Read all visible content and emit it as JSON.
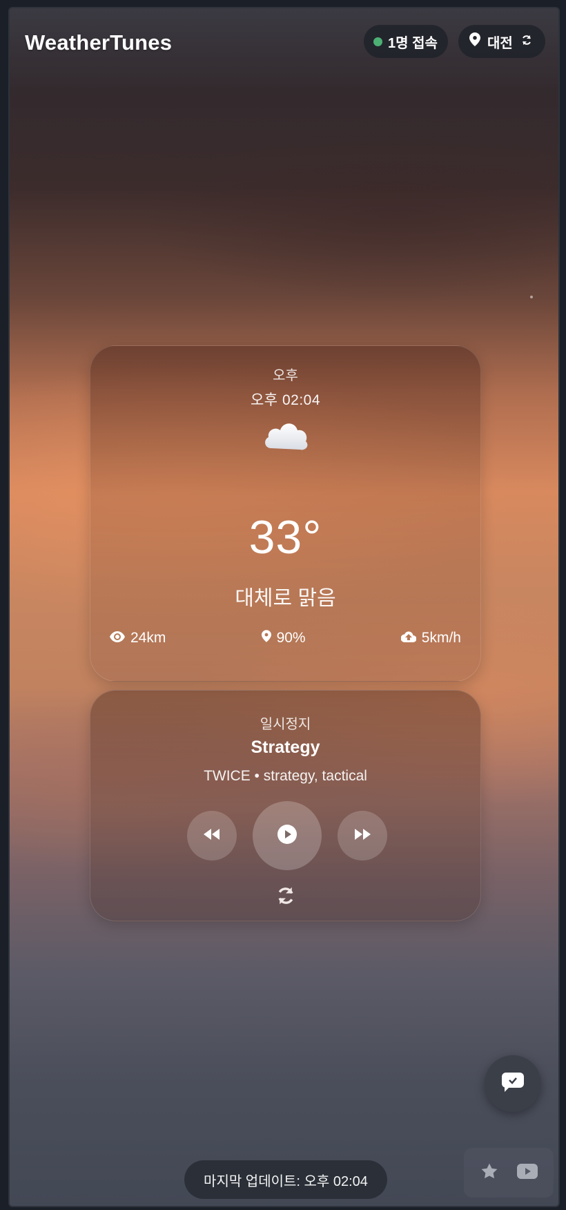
{
  "app": {
    "title": "WeatherTunes"
  },
  "header": {
    "users_label": "1명 접속",
    "city_label": "대전",
    "colors": {
      "online_dot": "#4caf74"
    }
  },
  "weather": {
    "period": "오후",
    "time": "오후 02:04",
    "condition_icon": "cloud-icon",
    "temperature": "33°",
    "description": "대체로 맑음",
    "visibility": "24km",
    "humidity": "90%",
    "wind": "5km/h"
  },
  "music": {
    "status": "일시정지",
    "title": "Strategy",
    "subtitle": "TWICE • strategy, tactical",
    "controls": [
      "previous-icon",
      "play-icon",
      "next-icon",
      "shuffle-refresh-icon"
    ]
  },
  "footer": {
    "last_update": "마지막 업데이트: 오후 02:04"
  },
  "floating": {
    "icons": [
      "chat-check-icon",
      "star-icon",
      "youtube-icon"
    ]
  }
}
